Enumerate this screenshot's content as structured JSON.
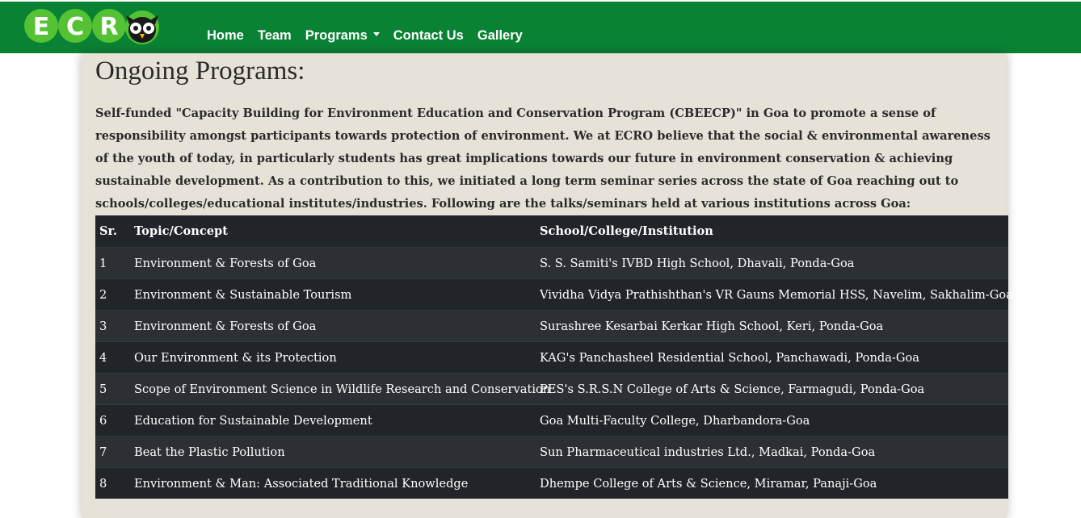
{
  "brand": {
    "logo_text": "ECR",
    "colors": {
      "navbar": "#0a8234",
      "page_background": "#e6e2d7",
      "table_dark": "#212529",
      "table_stripe": "#2c3034"
    }
  },
  "nav": {
    "items": [
      {
        "label": "Home"
      },
      {
        "label": "Team"
      },
      {
        "label": "Programs",
        "has_dropdown": true
      },
      {
        "label": "Contact Us"
      },
      {
        "label": "Gallery"
      }
    ]
  },
  "main": {
    "title": "Ongoing Programs:",
    "intro": "Self-funded \"Capacity Building for Environment Education and Conservation Program (CBEECP)\" in Goa to promote a sense of responsibility amongst participants towards protection of environment. We at ECRO believe that the social & environmental awareness of the youth of today, in particularly students has great implications towards our future in environment conservation & achieving sustainable development. As a contribution to this, we initiated a long term seminar series across the state of Goa reaching out to schools/colleges/educational institutes/industries. Following are the talks/seminars held at various institutions across Goa:",
    "table": {
      "headers": [
        "Sr.",
        "Topic/Concept",
        "School/College/Institution"
      ],
      "rows": [
        [
          "1",
          "Environment & Forests of Goa",
          "S. S. Samiti's IVBD High School, Dhavali, Ponda-Goa"
        ],
        [
          "2",
          "Environment & Sustainable Tourism",
          "Vividha Vidya Prathishthan's VR Gauns Memorial HSS, Navelim, Sakhalim-Goa"
        ],
        [
          "3",
          "Environment & Forests of Goa",
          "Surashree Kesarbai Kerkar High School, Keri, Ponda-Goa"
        ],
        [
          "4",
          "Our Environment & its Protection",
          "KAG's Panchasheel Residential School, Panchawadi, Ponda-Goa"
        ],
        [
          "5",
          "Scope of Environment Science in Wildlife Research and Conservation",
          "PES's S.R.S.N College of Arts & Science, Farmagudi, Ponda-Goa"
        ],
        [
          "6",
          "Education for Sustainable Development",
          "Goa Multi-Faculty College, Dharbandora-Goa"
        ],
        [
          "7",
          "Beat the Plastic Pollution",
          "Sun Pharmaceutical industries Ltd., Madkai, Ponda-Goa"
        ],
        [
          "8",
          "Environment & Man: Associated Traditional Knowledge",
          "Dhempe College of Arts & Science, Miramar, Panaji-Goa"
        ]
      ]
    }
  }
}
